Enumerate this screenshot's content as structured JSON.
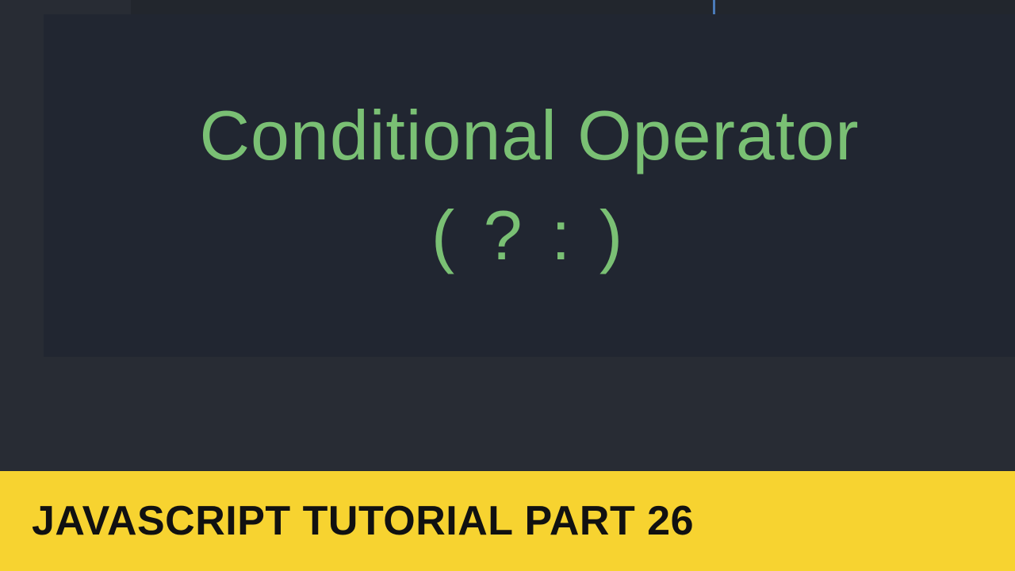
{
  "main": {
    "title_line1": "Conditional Operator",
    "title_line2": "( ? : )"
  },
  "banner": {
    "text": "JAVASCRIPT TUTORIAL PART 26"
  },
  "colors": {
    "background": "#282c34",
    "panel": "#212631",
    "heading_text": "#7ac074",
    "banner_bg": "#f7d330",
    "banner_text": "#111111",
    "accent": "#4a7ab8"
  }
}
